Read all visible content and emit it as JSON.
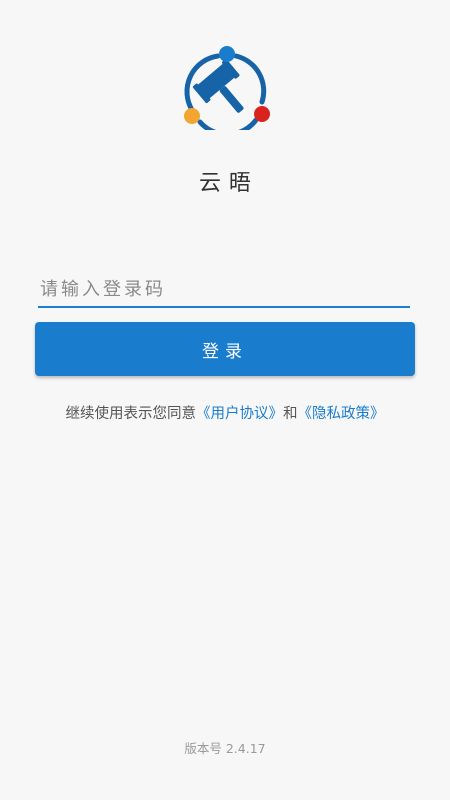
{
  "app": {
    "name": "云晤",
    "logo_icon": "gavel-icon",
    "colors": {
      "primary": "#1a7ccc",
      "logo_blue": "#1663a8",
      "logo_orange": "#f2a531",
      "logo_red": "#d9231c"
    }
  },
  "login": {
    "code_placeholder": "请输入登录码",
    "code_value": "",
    "button_label": "登录"
  },
  "agreement": {
    "prefix": "继续使用表示您同意",
    "user_agreement": "《用户协议》",
    "conjunction": "和",
    "privacy_policy": "《隐私政策》"
  },
  "footer": {
    "version_label": "版本号",
    "version": "2.4.17"
  }
}
